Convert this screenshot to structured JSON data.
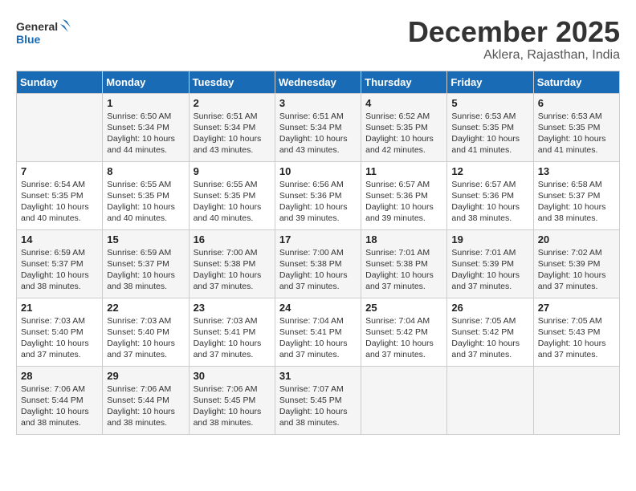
{
  "logo": {
    "text_general": "General",
    "text_blue": "Blue"
  },
  "title": "December 2025",
  "subtitle": "Aklera, Rajasthan, India",
  "headers": [
    "Sunday",
    "Monday",
    "Tuesday",
    "Wednesday",
    "Thursday",
    "Friday",
    "Saturday"
  ],
  "weeks": [
    [
      {
        "num": "",
        "info": ""
      },
      {
        "num": "1",
        "info": "Sunrise: 6:50 AM\nSunset: 5:34 PM\nDaylight: 10 hours\nand 44 minutes."
      },
      {
        "num": "2",
        "info": "Sunrise: 6:51 AM\nSunset: 5:34 PM\nDaylight: 10 hours\nand 43 minutes."
      },
      {
        "num": "3",
        "info": "Sunrise: 6:51 AM\nSunset: 5:34 PM\nDaylight: 10 hours\nand 43 minutes."
      },
      {
        "num": "4",
        "info": "Sunrise: 6:52 AM\nSunset: 5:35 PM\nDaylight: 10 hours\nand 42 minutes."
      },
      {
        "num": "5",
        "info": "Sunrise: 6:53 AM\nSunset: 5:35 PM\nDaylight: 10 hours\nand 41 minutes."
      },
      {
        "num": "6",
        "info": "Sunrise: 6:53 AM\nSunset: 5:35 PM\nDaylight: 10 hours\nand 41 minutes."
      }
    ],
    [
      {
        "num": "7",
        "info": "Sunrise: 6:54 AM\nSunset: 5:35 PM\nDaylight: 10 hours\nand 40 minutes."
      },
      {
        "num": "8",
        "info": "Sunrise: 6:55 AM\nSunset: 5:35 PM\nDaylight: 10 hours\nand 40 minutes."
      },
      {
        "num": "9",
        "info": "Sunrise: 6:55 AM\nSunset: 5:35 PM\nDaylight: 10 hours\nand 40 minutes."
      },
      {
        "num": "10",
        "info": "Sunrise: 6:56 AM\nSunset: 5:36 PM\nDaylight: 10 hours\nand 39 minutes."
      },
      {
        "num": "11",
        "info": "Sunrise: 6:57 AM\nSunset: 5:36 PM\nDaylight: 10 hours\nand 39 minutes."
      },
      {
        "num": "12",
        "info": "Sunrise: 6:57 AM\nSunset: 5:36 PM\nDaylight: 10 hours\nand 38 minutes."
      },
      {
        "num": "13",
        "info": "Sunrise: 6:58 AM\nSunset: 5:37 PM\nDaylight: 10 hours\nand 38 minutes."
      }
    ],
    [
      {
        "num": "14",
        "info": "Sunrise: 6:59 AM\nSunset: 5:37 PM\nDaylight: 10 hours\nand 38 minutes."
      },
      {
        "num": "15",
        "info": "Sunrise: 6:59 AM\nSunset: 5:37 PM\nDaylight: 10 hours\nand 38 minutes."
      },
      {
        "num": "16",
        "info": "Sunrise: 7:00 AM\nSunset: 5:38 PM\nDaylight: 10 hours\nand 37 minutes."
      },
      {
        "num": "17",
        "info": "Sunrise: 7:00 AM\nSunset: 5:38 PM\nDaylight: 10 hours\nand 37 minutes."
      },
      {
        "num": "18",
        "info": "Sunrise: 7:01 AM\nSunset: 5:38 PM\nDaylight: 10 hours\nand 37 minutes."
      },
      {
        "num": "19",
        "info": "Sunrise: 7:01 AM\nSunset: 5:39 PM\nDaylight: 10 hours\nand 37 minutes."
      },
      {
        "num": "20",
        "info": "Sunrise: 7:02 AM\nSunset: 5:39 PM\nDaylight: 10 hours\nand 37 minutes."
      }
    ],
    [
      {
        "num": "21",
        "info": "Sunrise: 7:03 AM\nSunset: 5:40 PM\nDaylight: 10 hours\nand 37 minutes."
      },
      {
        "num": "22",
        "info": "Sunrise: 7:03 AM\nSunset: 5:40 PM\nDaylight: 10 hours\nand 37 minutes."
      },
      {
        "num": "23",
        "info": "Sunrise: 7:03 AM\nSunset: 5:41 PM\nDaylight: 10 hours\nand 37 minutes."
      },
      {
        "num": "24",
        "info": "Sunrise: 7:04 AM\nSunset: 5:41 PM\nDaylight: 10 hours\nand 37 minutes."
      },
      {
        "num": "25",
        "info": "Sunrise: 7:04 AM\nSunset: 5:42 PM\nDaylight: 10 hours\nand 37 minutes."
      },
      {
        "num": "26",
        "info": "Sunrise: 7:05 AM\nSunset: 5:42 PM\nDaylight: 10 hours\nand 37 minutes."
      },
      {
        "num": "27",
        "info": "Sunrise: 7:05 AM\nSunset: 5:43 PM\nDaylight: 10 hours\nand 37 minutes."
      }
    ],
    [
      {
        "num": "28",
        "info": "Sunrise: 7:06 AM\nSunset: 5:44 PM\nDaylight: 10 hours\nand 38 minutes."
      },
      {
        "num": "29",
        "info": "Sunrise: 7:06 AM\nSunset: 5:44 PM\nDaylight: 10 hours\nand 38 minutes."
      },
      {
        "num": "30",
        "info": "Sunrise: 7:06 AM\nSunset: 5:45 PM\nDaylight: 10 hours\nand 38 minutes."
      },
      {
        "num": "31",
        "info": "Sunrise: 7:07 AM\nSunset: 5:45 PM\nDaylight: 10 hours\nand 38 minutes."
      },
      {
        "num": "",
        "info": ""
      },
      {
        "num": "",
        "info": ""
      },
      {
        "num": "",
        "info": ""
      }
    ]
  ]
}
